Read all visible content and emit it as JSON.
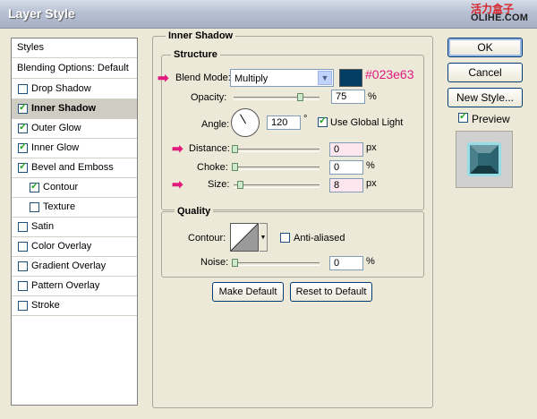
{
  "window": {
    "title": "Layer Style"
  },
  "watermark": {
    "cn": "活力盒子",
    "en": "OLIHE.COM"
  },
  "styles_list": {
    "header": "Styles",
    "blending": "Blending Options: Default",
    "items": [
      {
        "label": "Drop Shadow",
        "checked": false
      },
      {
        "label": "Inner Shadow",
        "checked": true,
        "active": true
      },
      {
        "label": "Outer Glow",
        "checked": true
      },
      {
        "label": "Inner Glow",
        "checked": true
      },
      {
        "label": "Bevel and Emboss",
        "checked": true
      },
      {
        "label": "Contour",
        "checked": true,
        "sub": true
      },
      {
        "label": "Texture",
        "checked": false,
        "sub": true
      },
      {
        "label": "Satin",
        "checked": false
      },
      {
        "label": "Color Overlay",
        "checked": false
      },
      {
        "label": "Gradient Overlay",
        "checked": false
      },
      {
        "label": "Pattern Overlay",
        "checked": false
      },
      {
        "label": "Stroke",
        "checked": false
      }
    ]
  },
  "inner_shadow": {
    "title": "Inner Shadow",
    "structure": {
      "title": "Structure",
      "blend_mode_label": "Blend Mode:",
      "blend_mode_value": "Multiply",
      "color_hex": "#023e63",
      "color_annotation": "#023e63",
      "opacity_label": "Opacity:",
      "opacity_value": "75",
      "opacity_unit": "%",
      "angle_label": "Angle:",
      "angle_value": "120",
      "angle_unit": "°",
      "global_light_label": "Use Global Light",
      "global_light_checked": true,
      "distance_label": "Distance:",
      "distance_value": "0",
      "distance_unit": "px",
      "choke_label": "Choke:",
      "choke_value": "0",
      "choke_unit": "%",
      "size_label": "Size:",
      "size_value": "8",
      "size_unit": "px"
    },
    "quality": {
      "title": "Quality",
      "contour_label": "Contour:",
      "anti_aliased_label": "Anti-aliased",
      "anti_aliased_checked": false,
      "noise_label": "Noise:",
      "noise_value": "0",
      "noise_unit": "%"
    },
    "make_default_label": "Make Default",
    "reset_default_label": "Reset to Default"
  },
  "buttons": {
    "ok": "OK",
    "cancel": "Cancel",
    "new_style": "New Style...",
    "preview_label": "Preview",
    "preview_checked": true
  }
}
